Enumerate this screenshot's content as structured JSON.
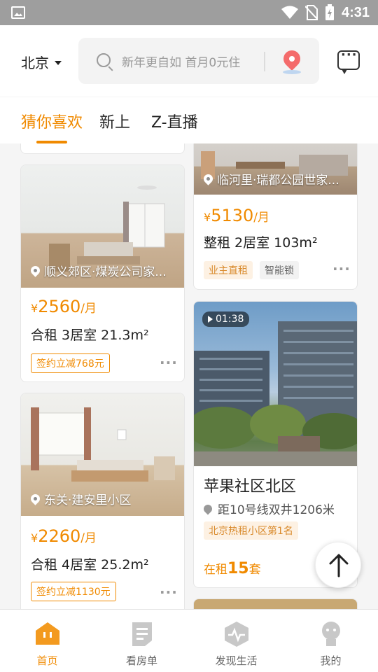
{
  "status_bar": {
    "time": "4:31"
  },
  "header": {
    "city": "北京",
    "search_placeholder": "新年更自如 首月0元住"
  },
  "tabs": [
    {
      "label": "猜你喜欢",
      "active": true
    },
    {
      "label": "新上",
      "active": false
    },
    {
      "label": "Z-直播",
      "active": false
    }
  ],
  "listings": [
    {
      "location": "临河里·瑞都公园世家...",
      "price_symbol": "¥",
      "price": "5130",
      "price_unit": "/月",
      "title": "整租 2居室 103m²",
      "tags": [
        "业主直租",
        "智能锁"
      ]
    },
    {
      "location": "顺义郊区·煤炭公司家...",
      "price_symbol": "¥",
      "price": "2560",
      "price_unit": "/月",
      "title": "合租 3居室 21.3m²",
      "tags": [
        "签约立减768元"
      ]
    },
    {
      "location": "东关·建安里小区",
      "price_symbol": "¥",
      "price": "2260",
      "price_unit": "/月",
      "title": "合租 4居室 25.2m²",
      "tags": [
        "签约立减1130元"
      ]
    }
  ],
  "community_card": {
    "video_duration": "01:38",
    "name": "苹果社区北区",
    "distance": "距10号线双井1206米",
    "badge": "北京热租小区第1名",
    "rent_prefix": "在租",
    "rent_count": "15",
    "rent_suffix": "套"
  },
  "bottom_nav": [
    {
      "label": "首页",
      "icon": "home-icon",
      "active": true
    },
    {
      "label": "看房单",
      "icon": "list-icon",
      "active": false
    },
    {
      "label": "发现生活",
      "icon": "discover-icon",
      "active": false
    },
    {
      "label": "我的",
      "icon": "profile-icon",
      "active": false
    }
  ],
  "colors": {
    "accent": "#f08a00",
    "status_bar": "#9e9e9e"
  }
}
